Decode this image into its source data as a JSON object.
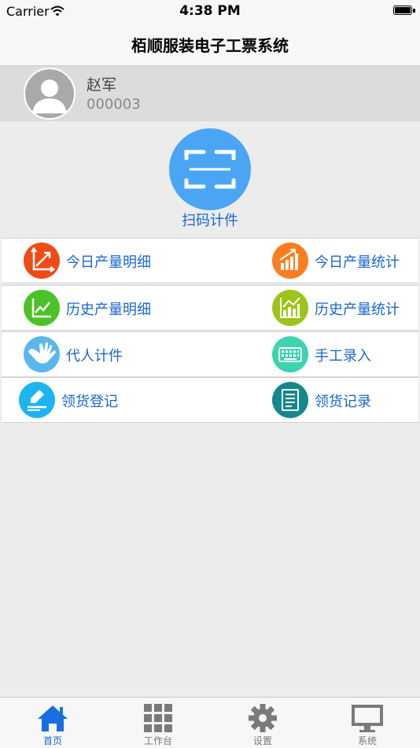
{
  "status_bar": {
    "carrier": "Carrier",
    "time": "4:38 PM"
  },
  "nav": {
    "title": "栢顺服装电子工票系统"
  },
  "user": {
    "name": "赵军",
    "id": "000003"
  },
  "scan": {
    "label": "扫码计件",
    "icon": "scan-frame-icon"
  },
  "menu": {
    "rows": [
      [
        {
          "label": "今日产量明细",
          "icon": "chart-axis-icon",
          "color": "#f04a17"
        },
        {
          "label": "今日产量统计",
          "icon": "bar-chart-icon",
          "color": "#fd7d1f"
        }
      ],
      [
        {
          "label": "历史产量明细",
          "icon": "line-chart-icon",
          "color": "#4cc229"
        },
        {
          "label": "历史产量统计",
          "icon": "bar-chart-icon",
          "color": "#9cc41a"
        }
      ],
      [
        {
          "label": "代人计件",
          "icon": "hand-icon",
          "color": "#5ab7ee"
        },
        {
          "label": "手工录入",
          "icon": "keyboard-icon",
          "color": "#3ed3b0"
        }
      ],
      [
        {
          "label": "领货登记",
          "icon": "sign-pen-icon",
          "color": "#1eb4f0"
        },
        {
          "label": "领货记录",
          "icon": "document-icon",
          "color": "#14888c"
        }
      ]
    ]
  },
  "tabs": [
    {
      "label": "首页",
      "icon": "home-icon",
      "active": true
    },
    {
      "label": "工作台",
      "icon": "grid-icon",
      "active": false
    },
    {
      "label": "设置",
      "icon": "gear-icon",
      "active": false
    },
    {
      "label": "系统",
      "icon": "monitor-icon",
      "active": false
    }
  ]
}
